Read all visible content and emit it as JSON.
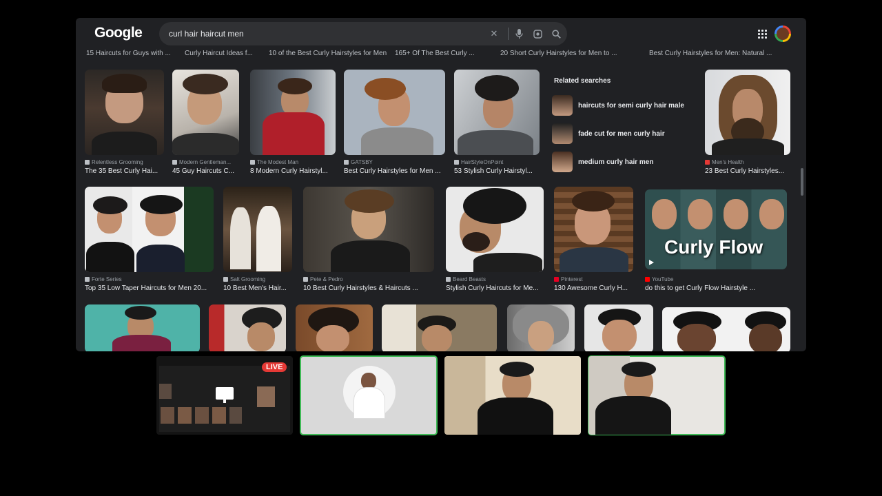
{
  "browser": {
    "logo": "Google",
    "search_value": "curl hair haircut men",
    "icons": [
      "close-icon",
      "mic-icon",
      "lens-icon",
      "search-icon",
      "apps-icon",
      "account-avatar"
    ]
  },
  "top_titles": [
    "15 Haircuts for Guys with ...",
    "Curly Haircut Ideas f...",
    "10 of the Best Curly Hairstyles for Men",
    "165+ Of The Best Curly ...",
    "20 Short Curly Hairstyles for Men to ...",
    "Best Curly Hairstyles for Men: Natural ..."
  ],
  "row1": [
    {
      "source": "Relentless Grooming",
      "title": "The 35 Best Curly Hai..."
    },
    {
      "source": "Modern Gentleman...",
      "title": "45 Guy Haircuts C..."
    },
    {
      "source": "The Modest Man",
      "title": "8 Modern Curly Hairstyl..."
    },
    {
      "source": "GATSBY",
      "title": "Best Curly Hairstyles for Men ..."
    },
    {
      "source": "HairStyleOnPoint",
      "title": "53 Stylish Curly Hairstyl..."
    },
    {
      "source": "Men's Health",
      "title": "23 Best Curly Hairstyles..."
    }
  ],
  "related": {
    "heading": "Related searches",
    "items": [
      "haircuts for semi curly hair male",
      "fade cut for men curly hair",
      "medium curly hair men"
    ]
  },
  "row2": [
    {
      "source": "Forte Series",
      "title": "Top 35 Low Taper Haircuts for Men 20..."
    },
    {
      "source": "Salt Grooming",
      "title": "10 Best Men's Hair..."
    },
    {
      "source": "Pete & Pedro",
      "title": "10 Best Curly Hairstyles & Haircuts ..."
    },
    {
      "source": "Beard Beasts",
      "title": "Stylish Curly Haircuts for Me..."
    },
    {
      "source": "Pinterest",
      "title": "130 Awesome Curly H..."
    },
    {
      "source": "YouTube",
      "title": "do this to get Curly Flow Hairstyle ...",
      "overlay": "Curly Flow"
    }
  ],
  "call": {
    "live_badge": "LIVE"
  },
  "colors": {
    "page_bg": "#202124",
    "speaking_outline": "#3fba56",
    "live_badge": "#e53935"
  }
}
